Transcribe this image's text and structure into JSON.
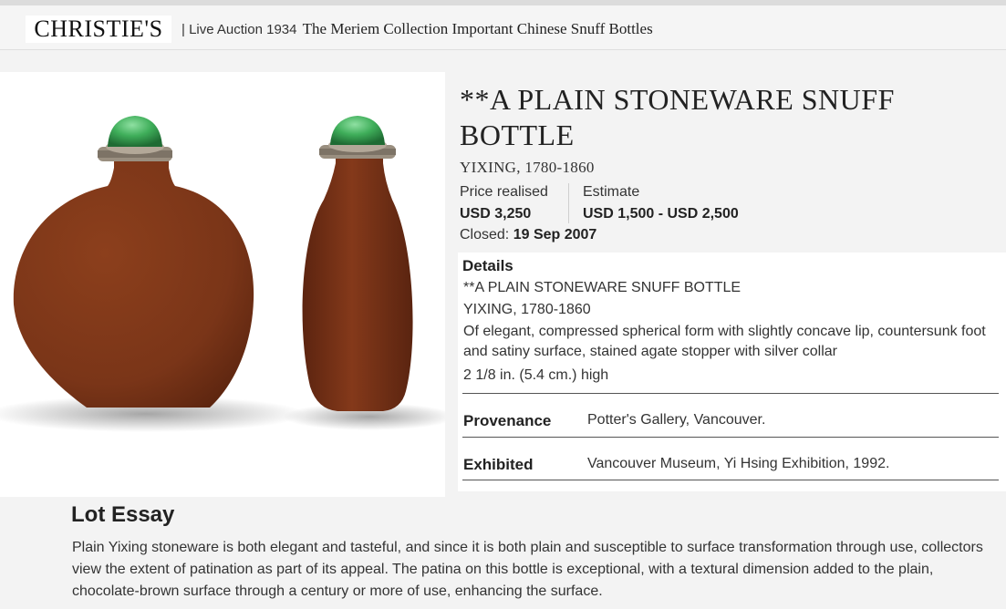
{
  "header": {
    "logo": "CHRISTIE'S",
    "crumb_prefix": "| Live Auction 1934",
    "sale_title": "The Meriem Collection Important Chinese Snuff Bottles"
  },
  "lot": {
    "title": "**A PLAIN STONEWARE SNUFF BOTTLE",
    "subtitle": "YIXING, 1780-1860",
    "price_label": "Price realised",
    "price_value": "USD 3,250",
    "estimate_label": "Estimate",
    "estimate_value": "USD 1,500 - USD 2,500",
    "closed_label": "Closed:",
    "closed_date": "19 Sep 2007"
  },
  "details": {
    "heading": "Details",
    "line1": "**A PLAIN STONEWARE SNUFF BOTTLE",
    "line2": "YIXING, 1780-1860",
    "line3": "Of elegant, compressed spherical form with slightly concave lip, countersunk foot and satiny surface, stained agate stopper with silver collar",
    "line4": "2 1/8 in. (5.4 cm.) high",
    "provenance_label": "Provenance",
    "provenance_value": "Potter's Gallery, Vancouver.",
    "exhibited_label": "Exhibited",
    "exhibited_value": "Vancouver Museum, Yi Hsing Exhibition, 1992."
  },
  "essay": {
    "heading": "Lot Essay",
    "text": "Plain Yixing stoneware is both elegant and tasteful, and since it is both plain and susceptible to surface transformation through use, collectors view the extent of patination as part of its appeal. The patina on this bottle is exceptional, with a textural dimension added to the plain, chocolate-brown surface through a century or more of use, enhancing the surface."
  },
  "colors": {
    "stoneware": "#7a3518",
    "stopper": "#3fae5a",
    "collar": "#9a8f80"
  }
}
